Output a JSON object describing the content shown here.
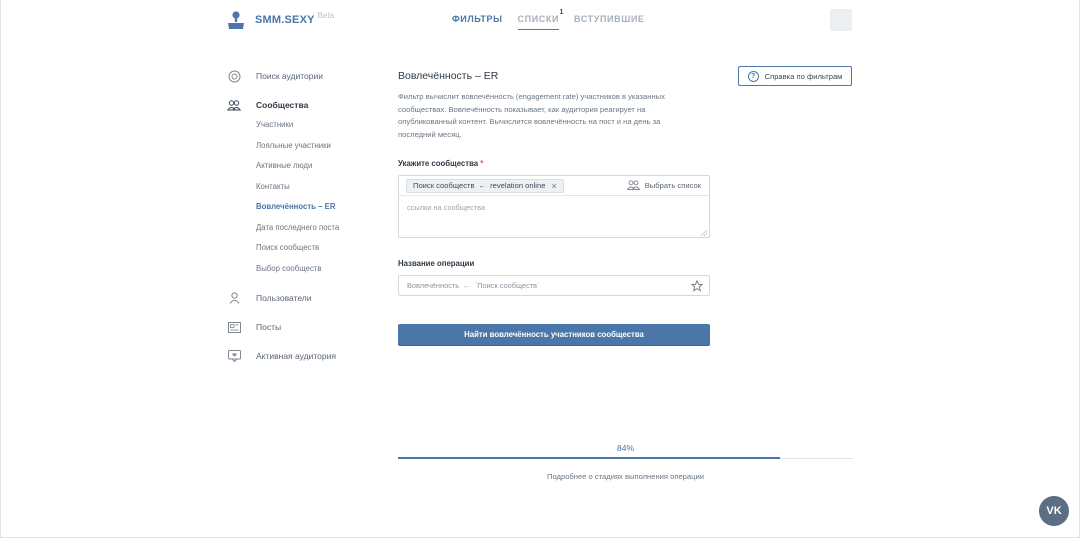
{
  "header": {
    "logo_text": "SMM.SEXY",
    "logo_beta": "Beta",
    "tabs": [
      {
        "label": "ФИЛЬТРЫ"
      },
      {
        "label": "СПИСКИ",
        "badge": "1"
      },
      {
        "label": "ВСТУПИВШИЕ"
      }
    ]
  },
  "sidebar": {
    "audience_search": "Поиск аудитории",
    "communities": "Сообщества",
    "community_items": [
      "Участники",
      "Лояльные участники",
      "Активные люди",
      "Контакты",
      "Вовлечённость – ER",
      "Дата последнего поста",
      "Поиск сообществ",
      "Выбор сообществ"
    ],
    "users": "Пользователи",
    "posts": "Посты",
    "active_audience": "Активная аудитория"
  },
  "main": {
    "title": "Вовлечённость – ER",
    "description": "Фильтр вычислит вовлечённость (engagement rate) участников в указанных сообществах. Вовлечённость показывает, как аудитория реагирует на опубликованный контент. Вычислится вовлечённость на пост и на день за последний месяц.",
    "help_button": "Справка по фильтрам",
    "communities_label": "Укажите сообщества",
    "required_mark": "*",
    "chip_source": "Поиск сообществ",
    "chip_arrow": "←",
    "chip_target": "revelation online",
    "chip_remove": "×",
    "choose_list": "Выбрать список",
    "links_placeholder": "ссылки на сообщества",
    "operation_label": "Название операции",
    "operation_value": "Вовлечённость  ←  `Поиск сообществ`",
    "submit": "Найти вовлечённость участников сообщества"
  },
  "progress": {
    "percent_text": "84%",
    "fraction": 0.84,
    "more_link": "Подробнее о стадиях выполнения операции"
  },
  "vk_button": "VK",
  "colors": {
    "accent": "#4a76a8",
    "text": "#3d4a58",
    "required": "#d9534f"
  }
}
